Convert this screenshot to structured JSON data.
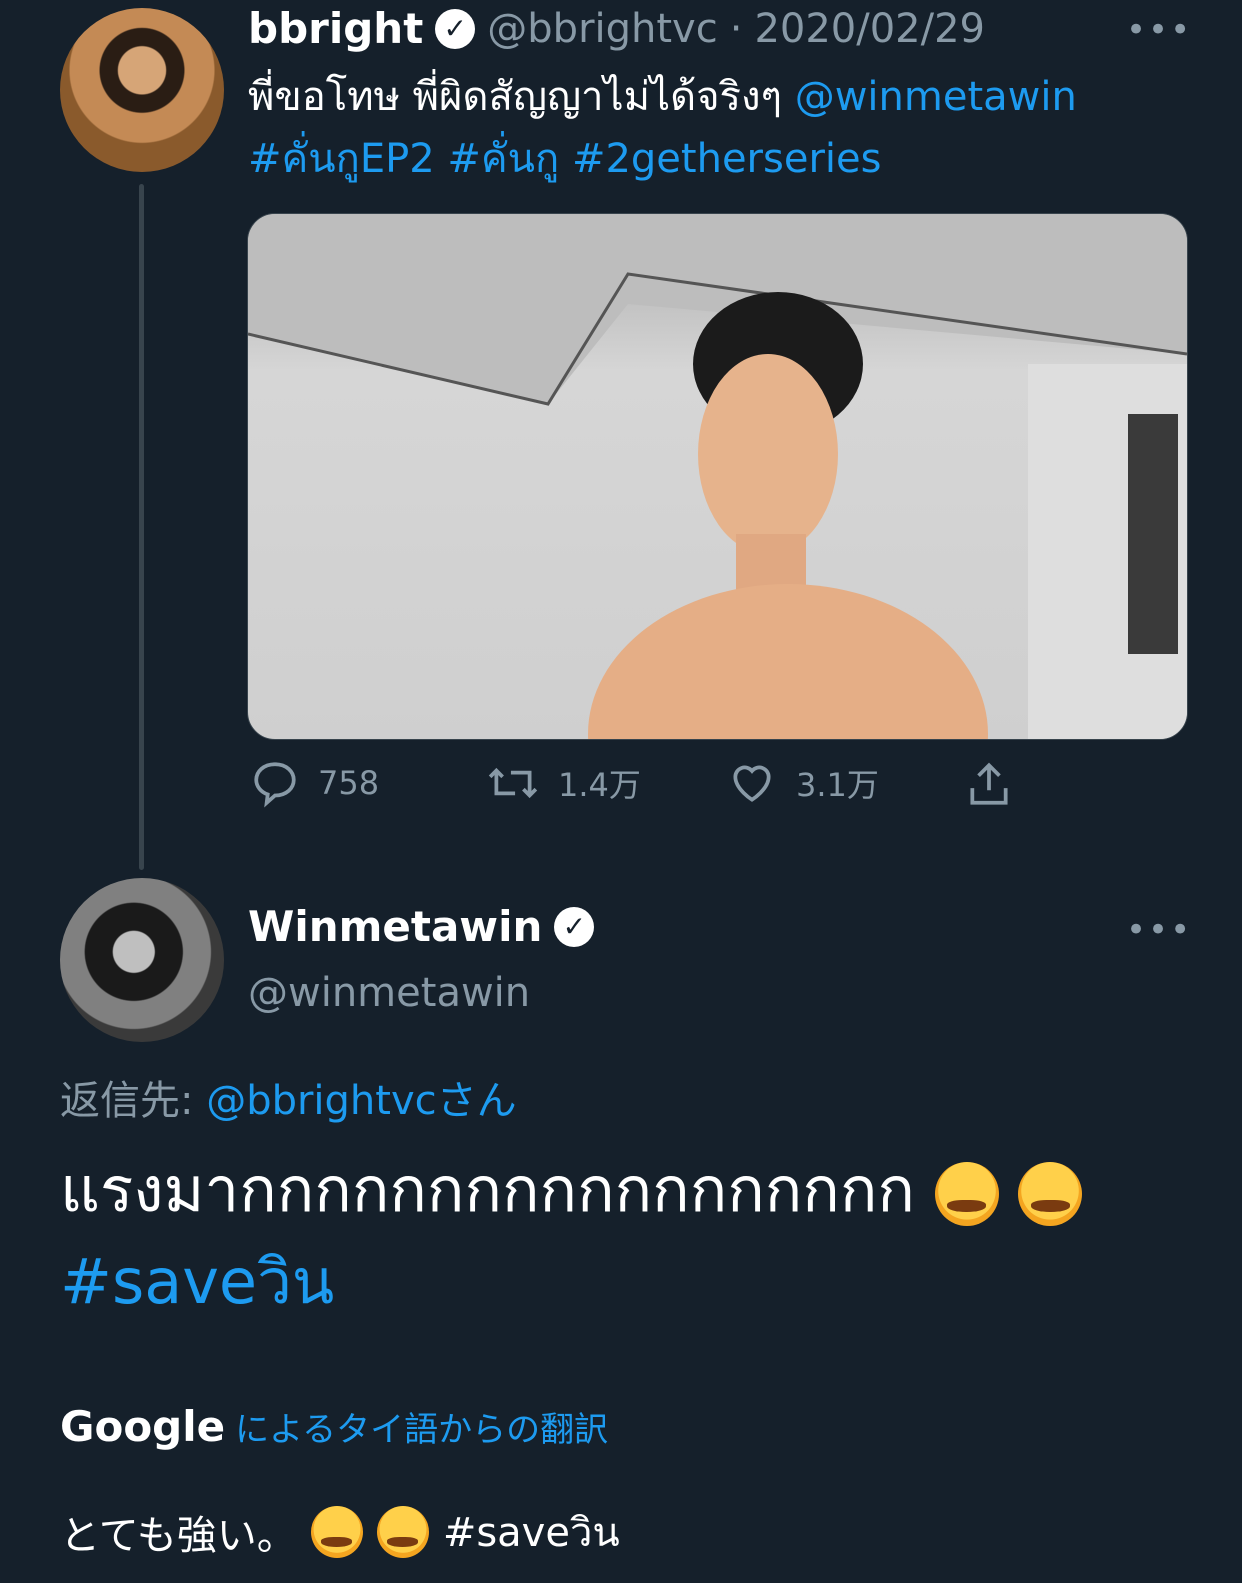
{
  "tweet1": {
    "display_name": "bbright",
    "handle": "@bbrightvc",
    "dot": "·",
    "date": "2020/02/29",
    "more": "•••",
    "text_line1": "พี่ขอโทษ พี่ผิดสัญญาไม่ได้จริงๆ ",
    "mention": "@winmetawin",
    "hashtags_line2": "#คั่นกูEP2 #คั่นกู #2getherseries",
    "actions": {
      "reply_count": "758",
      "retweet_count": "1.4万",
      "like_count": "3.1万"
    }
  },
  "tweet2": {
    "display_name": "Winmetawin",
    "handle": "@winmetawin",
    "more": "•••",
    "reply_to_label": "返信先: ",
    "reply_to_handle": "@bbrightvcさん",
    "text": "แรงมากกกกกกกกกกกกกกกกกก",
    "hashtag": "#saveวิน",
    "translation_source_brand": "Google",
    "translation_label": "によるタイ語からの翻訳",
    "translation_text": "とても強い。",
    "translation_hashtag": "#saveวิน"
  },
  "icons": {
    "verified": "verified-badge-icon",
    "reply": "comment-bubble-icon",
    "retweet": "retweet-icon",
    "like": "heart-icon",
    "share": "share-upload-icon",
    "emoji": "loudly-crying-face-emoji"
  },
  "colors": {
    "background": "#15202b",
    "link": "#1d9bf0",
    "muted": "#8899a6"
  }
}
